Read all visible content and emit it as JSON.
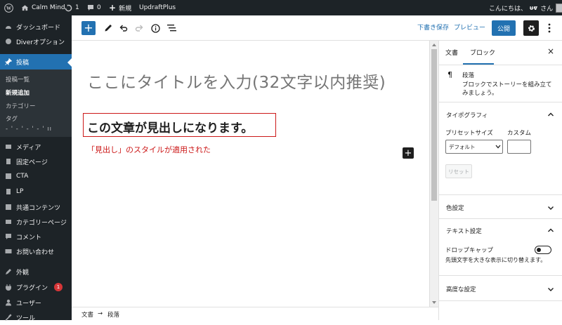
{
  "admin_bar": {
    "site_name": "Calm Mind",
    "updates_count": "1",
    "comments_count": "0",
    "new_label": "新規",
    "plugin_label": "UpdraftPlus",
    "greeting": "こんにちは、",
    "username": "ᵾⱴ",
    "greeting_suffix": "さん"
  },
  "sidebar": {
    "items": [
      {
        "label": "ダッシュボード",
        "icon": "dashboard-icon"
      },
      {
        "label": "Diverオプション",
        "icon": "diver-icon"
      },
      {
        "label": "投稿",
        "icon": "pin-icon",
        "active": true
      },
      {
        "label": "メディア",
        "icon": "media-icon"
      },
      {
        "label": "固定ページ",
        "icon": "page-icon"
      },
      {
        "label": "CTA",
        "icon": "cta-icon"
      },
      {
        "label": "LP",
        "icon": "lp-icon"
      },
      {
        "label": "共通コンテンツ",
        "icon": "content-icon"
      },
      {
        "label": "カテゴリーページ",
        "icon": "category-page-icon"
      },
      {
        "label": "コメント",
        "icon": "comment-icon"
      },
      {
        "label": "お問い合わせ",
        "icon": "mail-icon"
      },
      {
        "label": "外観",
        "icon": "appearance-icon"
      },
      {
        "label": "プラグイン",
        "icon": "plugin-icon",
        "badge": "1"
      },
      {
        "label": "ユーザー",
        "icon": "user-icon"
      },
      {
        "label": "ツール",
        "icon": "tool-icon"
      }
    ],
    "submenu": [
      {
        "label": "投稿一覧"
      },
      {
        "label": "新規追加",
        "current": true
      },
      {
        "label": "カテゴリー"
      },
      {
        "label": "タグ"
      },
      {
        "label": "- ' - ' - ' -  ' ıı"
      }
    ]
  },
  "toolbar": {
    "save_draft": "下書き保存",
    "preview": "プレビュー",
    "publish": "公開"
  },
  "editor": {
    "title_placeholder": "ここにタイトルを入力(32文字以内推奨)",
    "heading_text": "この文章が見出しになります。",
    "note_text": "「見出し」のスタイルが適用された"
  },
  "breadcrumb": {
    "root": "文書",
    "arrow": "→",
    "current": "段落"
  },
  "settings_panel": {
    "tabs": [
      "文書",
      "ブロック"
    ],
    "active_tab": "ブロック",
    "close": "×",
    "block": {
      "name": "段落",
      "description_line1": "ブロックでストーリーを組み立て",
      "description_line2": "みましょう。",
      "icon_glyph": "¶"
    },
    "typography": {
      "title": "タイポグラフィ",
      "preset_label": "プリセットサイズ",
      "custom_label": "カスタム",
      "preset_value": "デフォルト",
      "reset_label": "リセット"
    },
    "color_title": "色設定",
    "text_settings": {
      "title": "テキスト設定",
      "dropcap_label": "ドロップキャップ",
      "dropcap_help": "先頭文字を大きな表示に切り替えます。"
    },
    "advanced_title": "高度な設定"
  },
  "colors": {
    "admin_dark": "#1d2327",
    "accent": "#2271b1",
    "heading_highlight": "#cc1818"
  }
}
